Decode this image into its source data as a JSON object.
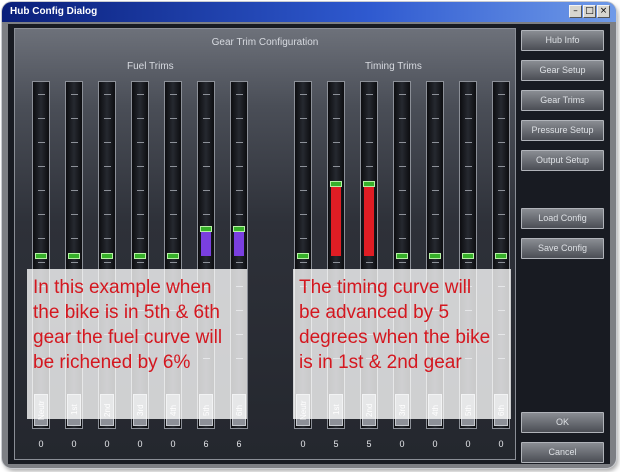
{
  "window": {
    "title": "Hub Config Dialog",
    "controls": [
      "–",
      "□",
      "×"
    ]
  },
  "panel": {
    "title": "Gear Trim Configuration",
    "fuel_title": "Fuel Trims",
    "timing_title": "Timing Trims"
  },
  "fuel_trims": [
    {
      "gear": "Neutr",
      "value": "0"
    },
    {
      "gear": "1st",
      "value": "0"
    },
    {
      "gear": "2nd",
      "value": "0"
    },
    {
      "gear": "3rd",
      "value": "0"
    },
    {
      "gear": "4th",
      "value": "0"
    },
    {
      "gear": "5th",
      "value": "6"
    },
    {
      "gear": "6th",
      "value": "6"
    }
  ],
  "timing_trims": [
    {
      "gear": "Neutr",
      "value": "0"
    },
    {
      "gear": "1st",
      "value": "5"
    },
    {
      "gear": "2nd",
      "value": "5"
    },
    {
      "gear": "3rd",
      "value": "0"
    },
    {
      "gear": "4th",
      "value": "0"
    },
    {
      "gear": "5th",
      "value": "0"
    },
    {
      "gear": "6th",
      "value": "0"
    }
  ],
  "annotations": {
    "fuel": [
      "In this example when",
      "the bike is in 5th & 6th",
      "gear the fuel curve will",
      "be richened by 6%"
    ],
    "timing": [
      "The timing curve will",
      "be advanced by 5",
      "degrees when the bike",
      "is in 1st & 2nd gear"
    ]
  },
  "buttons": {
    "hub_info": "Hub Info",
    "gear_setup": "Gear Setup",
    "gear_trims": "Gear Trims",
    "pressure_setup": "Pressure Setup",
    "output_setup": "Output Setup",
    "load_config": "Load Config",
    "save_config": "Save Config",
    "ok": "OK",
    "cancel": "Cancel"
  },
  "colors": {
    "fuel_fill": "#7a3fe0",
    "timing_fill": "#e01d24",
    "thumb": "#37b02a",
    "annotation_text": "#d4171f"
  }
}
